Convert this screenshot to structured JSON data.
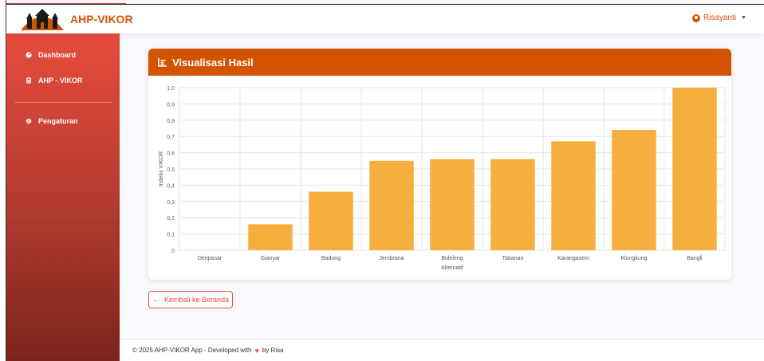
{
  "brand": {
    "name": "AHP-VIKOR",
    "accent": "#d35400"
  },
  "user": {
    "name": "Risayanti",
    "icon": "user-circle-icon"
  },
  "sidebar": {
    "items": [
      {
        "label": "Dashboard",
        "icon": "dashboard-icon"
      },
      {
        "label": "AHP - VIKOR",
        "icon": "calculator-icon"
      },
      {
        "label": "Pengaturan",
        "icon": "gear-icon"
      }
    ]
  },
  "card": {
    "title": "Visualisasi Hasil",
    "icon": "chart-bar-icon"
  },
  "chart_data": {
    "type": "bar",
    "categories": [
      "Denpasar",
      "Gianyar",
      "Badung",
      "Jembrana",
      "Buleleng",
      "Tabanan",
      "Karangasem",
      "Klungkung",
      "Bangli"
    ],
    "values": [
      0,
      0.16,
      0.36,
      0.55,
      0.56,
      0.56,
      0.67,
      0.74,
      1.0
    ],
    "xlabel": "Alternatif",
    "ylabel": "Indeks VIKOR",
    "ylim": [
      0,
      1.0
    ],
    "yticks": [
      "0",
      "0,1",
      "0,2",
      "0,3",
      "0,4",
      "0,5",
      "0,6",
      "0,7",
      "0,8",
      "0,9",
      "1,0"
    ],
    "bar_color": "#f5ab35",
    "grid": true
  },
  "back_button": {
    "label": "Kembali ke Beranda",
    "icon": "arrow-left-icon"
  },
  "footer": {
    "text_before": "© 2025 AHP-VIKOR App - Developed with",
    "text_after": "by Risa",
    "icon": "heart-icon"
  }
}
